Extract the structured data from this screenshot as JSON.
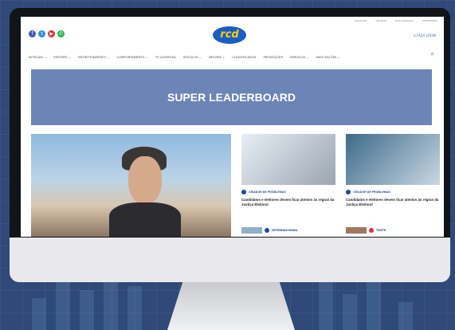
{
  "util_links": [
    "SEGUE-NS",
    "ANUNCIE",
    "FALE CONOSCO",
    "EXPEDIENTE"
  ],
  "social_icons": [
    {
      "name": "facebook-icon",
      "glyph": "f",
      "color": "#3b5bb5"
    },
    {
      "name": "twitter-icon",
      "glyph": "t",
      "color": "#2d8fd8"
    },
    {
      "name": "youtube-icon",
      "glyph": "▶",
      "color": "#d33"
    },
    {
      "name": "whatsapp-icon",
      "glyph": "✆",
      "color": "#2bb24c"
    }
  ],
  "logo_text": "rcd",
  "login_label": "⚲ FAÇA LOGIN",
  "nav_items": [
    "NOTÍCIAS ⌄",
    "ESPORTE ⌄",
    "ENTRETENIMENTO ⌄",
    "COMPORTAMENTO ⌄",
    "TV ALTEROSA",
    "VEÍCULOS ⌄",
    "IMÓVEIS ⌄",
    "CLASSIFICADOS",
    "PROMOÇÕES",
    "SERVIÇOS ⌄",
    "MAIS SEÇÕES ⌄"
  ],
  "search_glyph": "⌕",
  "leaderboard_label": "SUPER LEADERBOARD",
  "cards": [
    {
      "category": "CRIADOR DE PROBLEMAS",
      "title": "Candidatos e eleitores devem ficar atentos às regras da Justiça Eleitoral"
    },
    {
      "category": "CRIADOR DE PROBLEMAS",
      "title": "Candidatos e eleitores devem ficar atentos às regras da Justiça Eleitoral"
    }
  ],
  "row2": [
    {
      "category": "INTERNACIONAL"
    },
    {
      "category": "TESTE"
    }
  ],
  "pin_glyph": "▫"
}
